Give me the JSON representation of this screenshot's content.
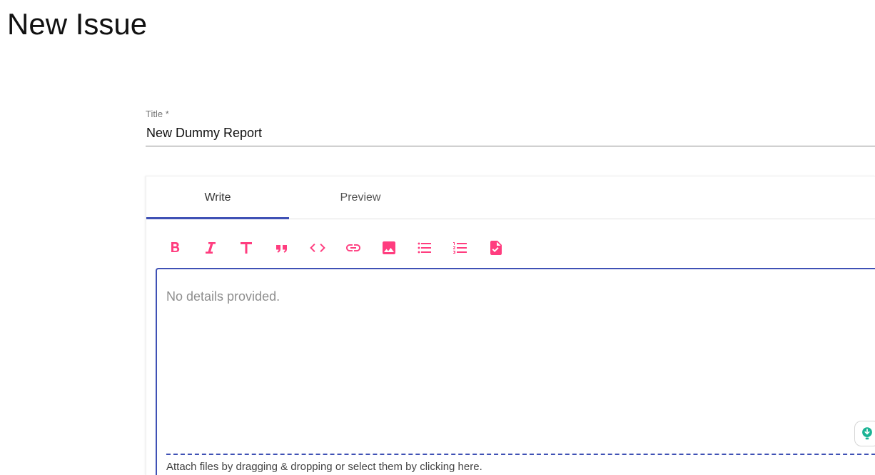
{
  "page": {
    "title": "New Issue"
  },
  "title_field": {
    "label": "Title *",
    "value": "New Dummy Report"
  },
  "editor": {
    "tabs": [
      {
        "label": "Write",
        "active": true
      },
      {
        "label": "Preview",
        "active": false
      }
    ],
    "toolbar": {
      "accent_color": "#ff3d7f",
      "tools": [
        {
          "name": "bold-icon"
        },
        {
          "name": "italic-icon"
        },
        {
          "name": "heading-icon"
        },
        {
          "name": "quote-icon"
        },
        {
          "name": "code-icon"
        },
        {
          "name": "link-icon"
        },
        {
          "name": "image-icon"
        },
        {
          "name": "unordered-list-icon"
        },
        {
          "name": "ordered-list-icon"
        },
        {
          "name": "checked-file-icon"
        }
      ]
    },
    "body": {
      "placeholder": "No details provided.",
      "value": ""
    },
    "attach_hint": "Attach files by dragging & dropping or select them by clicking here.",
    "focus_color": "#3f51b5"
  },
  "assist_button": {
    "icon": "lightbulb-icon",
    "color": "#1ab394"
  }
}
